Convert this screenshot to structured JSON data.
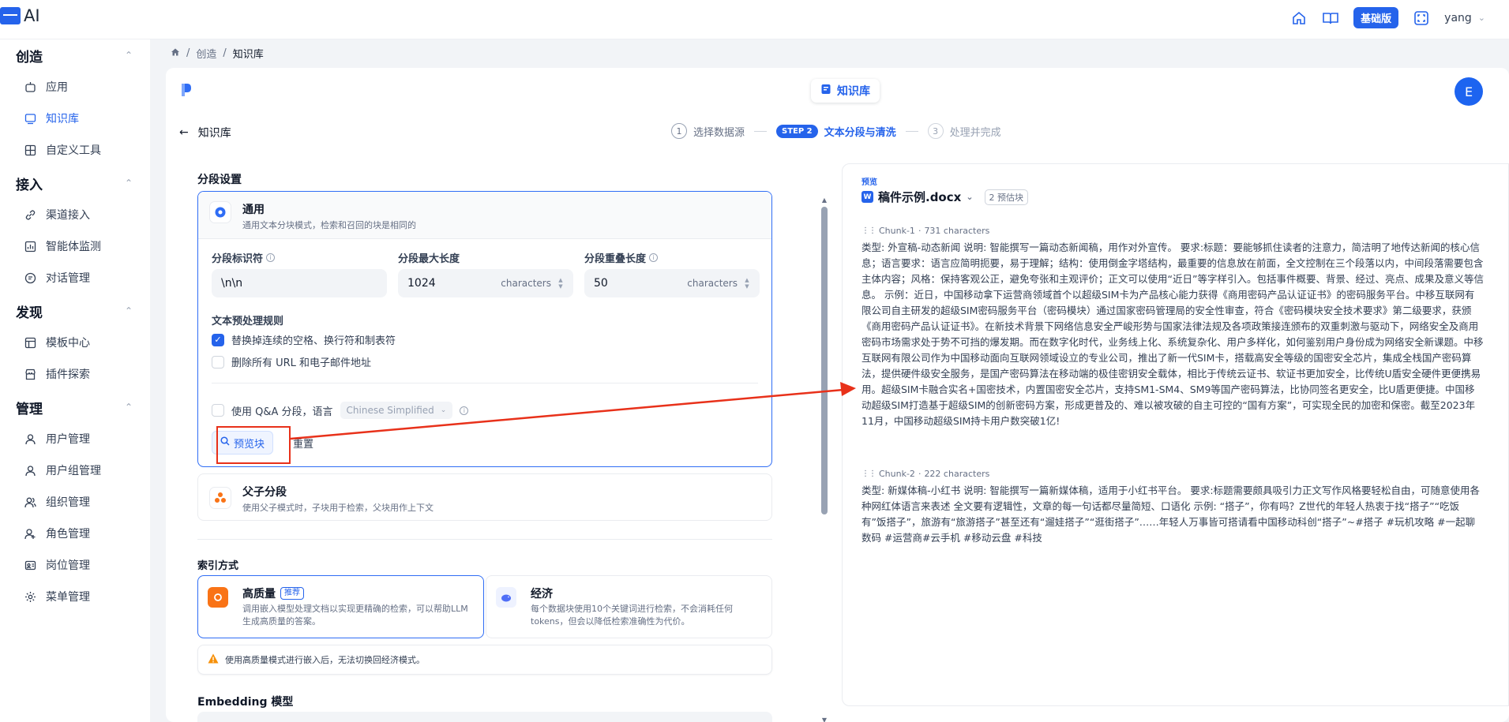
{
  "app": {
    "title": "AI"
  },
  "topbar": {
    "plan": "基础版",
    "user": "yang"
  },
  "sidebar": {
    "sections": [
      {
        "title": "创造",
        "items": [
          "应用",
          "知识库",
          "自定义工具"
        ]
      },
      {
        "title": "接入",
        "items": [
          "渠道接入",
          "智能体监测",
          "对话管理"
        ]
      },
      {
        "title": "发现",
        "items": [
          "模板中心",
          "插件探索"
        ]
      },
      {
        "title": "管理",
        "items": [
          "用户管理",
          "用户组管理",
          "组织管理",
          "角色管理",
          "岗位管理",
          "菜单管理"
        ]
      }
    ]
  },
  "breadcrumb": [
    "创造",
    "知识库"
  ],
  "header": {
    "pill": "知识库",
    "avatar": "E",
    "back_label": "知识库"
  },
  "steps": [
    {
      "num": "1",
      "label": "选择数据源"
    },
    {
      "num": "STEP 2",
      "label": "文本分段与清洗"
    },
    {
      "num": "3",
      "label": "处理并完成"
    }
  ],
  "segment": {
    "section_title": "分段设置",
    "mode_title": "通用",
    "mode_desc": "通用文本分块模式，检索和召回的块是相同的",
    "delimiter_label": "分段标识符",
    "delimiter_value": "\\n\\n",
    "max_len_label": "分段最大长度",
    "max_len_value": "1024",
    "overlap_label": "分段重叠长度",
    "overlap_value": "50",
    "unit": "characters",
    "rules_title": "文本预处理规则",
    "rule1": "替换掉连续的空格、换行符和制表符",
    "rule2": "删除所有 URL 和电子邮件地址",
    "qa_label": "使用 Q&A 分段，语言",
    "qa_lang": "Chinese Simplified",
    "preview_btn": "预览块",
    "reset_btn": "重置"
  },
  "parent_child": {
    "title": "父子分段",
    "desc": "使用父子模式时，子块用于检索，父块用作上下文"
  },
  "index": {
    "section_title": "索引方式",
    "hq_title": "高质量",
    "hq_badge": "推荐",
    "hq_desc": "调用嵌入模型处理文档以实现更精确的检索，可以帮助LLM生成高质量的答案。",
    "eco_title": "经济",
    "eco_desc": "每个数据块使用10个关键词进行检索，不会消耗任何 tokens，但会以降低检索准确性为代价。",
    "warning": "使用高质量模式进行嵌入后，无法切换回经济模式。"
  },
  "embedding": {
    "title": "Embedding 模型"
  },
  "preview": {
    "label": "预览",
    "file": "稿件示例.docx",
    "count": "2 预估块",
    "chunks": [
      {
        "id": "Chunk-1",
        "chars": "731 characters",
        "text": "类型: 外宣稿-动态新闻 说明: 智能撰写一篇动态新闻稿，用作对外宣传。 要求:标题：要能够抓住读者的注意力，简洁明了地传达新闻的核心信息；语言要求：语言应简明扼要，易于理解；结构：使用倒金字塔结构，最重要的信息放在前面，全文控制在三个段落以内，中间段落需要包含主体内容；风格：保持客观公正，避免夸张和主观评价；正文可以使用“近日”等字样引入。包括事件概要、背景、经过、亮点、成果及意义等信息。 示例：近日，中国移动拿下运营商领域首个以超级SIM卡为产品核心能力获得《商用密码产品认证证书》的密码服务平台。中移互联网有限公司自主研发的超级SIM密码服务平台（密码模块）通过国家密码管理局的安全性审查，符合《密码模块安全技术要求》第二级要求，获颁《商用密码产品认证证书》。在新技术背景下网络信息安全严峻形势与国家法律法规及各项政策接连颁布的双重刺激与驱动下，网络安全及商用密码市场需求处于势不可挡的爆发期。而在数字化时代，业务线上化、系统复杂化、用户多样化，如何鉴别用户身份成为网络安全新课题。中移互联网有限公司作为中国移动面向互联网领域设立的专业公司，推出了新一代SIM卡，搭载高安全等级的国密安全芯片，集成全栈国产密码算法，提供硬件级安全服务，是国产密码算法在移动端的极佳密钥安全载体，相比于传统云证书、软证书更加安全，比传统U盾安全硬件更便携易用。超级SIM卡融合实名+国密技术，内置国密安全芯片，支持SM1-SM4、SM9等国产密码算法，比协同签名更安全，比U盾更便捷。中国移动超级SIM打造基于超级SIM的创新密码方案，形成更普及的、难以被攻破的自主可控的“国有方案”，可实现全民的加密和保密。截至2023年11月，中国移动超级SIM持卡用户数突破1亿!"
      },
      {
        "id": "Chunk-2",
        "chars": "222 characters",
        "text": "类型: 新媒体稿-小红书 说明: 智能撰写一篇新媒体稿，适用于小红书平台。 要求:标题需要颇具吸引力正文写作风格要轻松自由，可随意使用各种网红体语言来表述 全文要有逻辑性，文章的每一句话都尽量简短、口语化 示例: “搭子”，你有吗？Z世代的年轻人热衷于找“搭子”“吃饭有”饭搭子”，旅游有“旅游搭子”甚至还有“遛娃搭子”“逛街搭子”……年轻人万事皆可搭请看中国移动科创“搭子”~#搭子 #玩机攻略 #一起聊数码 #运营商#云手机 #移动云盘 #科技"
      }
    ]
  }
}
